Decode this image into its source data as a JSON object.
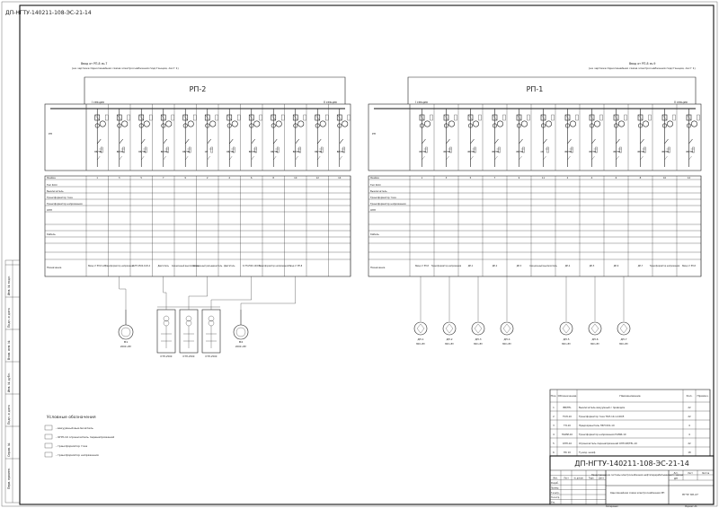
{
  "sheet": {
    "rotated_code": "ДП-НГТУ-140211-108-ЭС-21-14",
    "side_labels": [
      "Перв. примен.",
      "Справ. №",
      "Подп. и дата",
      "Инв. № дубл.",
      "Взам. инв. №",
      "Подп. и дата",
      "Инв. № подл."
    ]
  },
  "sections": [
    {
      "id": "left",
      "title": "РП-2",
      "feed_note_1": "Ввод от РП-8 яч.7",
      "feed_note_2": "(на чертеже Однолинейная схема электроснабжения подстанции, лист 1)",
      "bus_left_label": "I секция",
      "bus_right_label": "II секция",
      "cell_numbers": [
        "1",
        "3",
        "5",
        "7",
        "9",
        "2",
        "4",
        "6",
        "8",
        "10",
        "12",
        "14"
      ],
      "device_labels": [
        "ВВ/TEL",
        "ВВ/TEL",
        "ВВ/TEL",
        "ВВ/TEL",
        "ВВ/TEL",
        "СВ",
        "ВВ/TEL",
        "ВВ/TEL",
        "ВВ/TEL",
        "ВВ/TEL",
        "ВВ/TEL",
        "ВВ/TEL"
      ],
      "bottom_labels": [
        "Ввод от РП-8 яч.7",
        "Трансформатор напряжения",
        "К-ТП-2500-10/0,4",
        "Двигатель",
        "Секционный выключатель",
        "Секционный разъединитель",
        "Двигатель",
        "К-ТП-2500-10/0,4",
        "Трансформатор напряжения",
        "Ввод от РП-8"
      ],
      "row_titles": [
        "Ячейка",
        "Тип КСО",
        "Выключатель",
        "Трансформатор тока",
        "Трансформатор напряжения",
        "ОПН",
        "Кабель",
        "Назначение"
      ],
      "loads": [
        {
          "type": "motor",
          "label": "М1",
          "sub": "2000 кВт"
        },
        {
          "type": "ktp",
          "label": "КТП-2500"
        },
        {
          "type": "ktp",
          "label": "КТП-2500"
        },
        {
          "type": "ktp",
          "label": "КТП-2500"
        },
        {
          "type": "motor",
          "label": "М2",
          "sub": "2000 кВт"
        }
      ]
    },
    {
      "id": "right",
      "title": "РП-1",
      "feed_note_1": "Ввод от РП-8 яч.9",
      "feed_note_2": "(на чертеже Однолинейная схема электроснабжения подстанции, лист 1)",
      "bus_left_label": "I секция",
      "bus_right_label": "II секция",
      "cell_numbers": [
        "1",
        "3",
        "5",
        "7",
        "9",
        "11",
        "2",
        "4",
        "6",
        "8",
        "10",
        "12"
      ],
      "device_labels": [
        "ВВ/TEL",
        "ВВ/TEL",
        "ВВ/TEL",
        "ВВ/TEL",
        "ВВ/TEL",
        "СВ",
        "ВВ/TEL",
        "ВВ/TEL",
        "ВВ/TEL",
        "ВВ/TEL",
        "ВВ/TEL",
        "ВВ/TEL"
      ],
      "bottom_labels": [
        "Ввод от РП-8",
        "Трансформатор напряжения",
        "ДП-1",
        "ДП-2",
        "ДП-3",
        "Секционный выключатель",
        "ДП-4",
        "ДП-5",
        "ДП-6",
        "ДП-7",
        "Трансформатор напряжения",
        "Ввод от РП-8"
      ],
      "row_titles": [
        "Ячейка",
        "Тип КСО",
        "Выключатель",
        "Трансформатор тока",
        "Трансформатор напряжения",
        "ОПН",
        "Кабель",
        "Назначение"
      ],
      "loads": [
        {
          "type": "pump",
          "label": "ДП-1",
          "sub": "800 кВт"
        },
        {
          "type": "pump",
          "label": "ДП-2",
          "sub": "800 кВт"
        },
        {
          "type": "pump",
          "label": "ДП-3",
          "sub": "800 кВт"
        },
        {
          "type": "pump",
          "label": "ДП-4",
          "sub": "800 кВт"
        },
        {
          "type": "pump",
          "label": "ДП-5",
          "sub": "800 кВт"
        },
        {
          "type": "pump",
          "label": "ДП-6",
          "sub": "800 кВт"
        },
        {
          "type": "pump",
          "label": "ДП-7",
          "sub": "800 кВт"
        }
      ]
    }
  ],
  "legend": {
    "title": "Условные обозначения",
    "items": [
      "- вакуумный выключатель",
      "- ОПН-10 ограничитель перенапряжений",
      "- трансформатор тока",
      "- трансформатор напряжения"
    ]
  },
  "spec": {
    "headers": [
      "Поз.",
      "Обозначение",
      "Наименование",
      "Кол.",
      "Примеч."
    ],
    "rows": [
      [
        "1",
        "ВВ/TEL",
        "Выключатель вакуумный с приводом",
        "22",
        ""
      ],
      [
        "2",
        "ТОЛ-10",
        "Трансформатор тока ТОЛ-10-1-100/5",
        "22",
        ""
      ],
      [
        "3",
        "ТЛ-10",
        "Предохранитель ПКН 001-10",
        "4",
        ""
      ],
      [
        "4",
        "НАМИ-10",
        "Трансформатор напряжения НАМИ-10",
        "4",
        ""
      ],
      [
        "5",
        "ОПН-10",
        "Ограничитель перенапряжений ОПН-КР/TEL-10",
        "22",
        ""
      ],
      [
        "6",
        "ПК 10",
        "Ту-вод. шкаф",
        "18",
        ""
      ]
    ]
  },
  "title_block": {
    "code": "ДП-НГТУ-140211-108-ЭС-21-14",
    "project": "Проектирование системы электроснабжения нефтеперерабатывающего завода",
    "sheet_name": "Однолинейная схема электроснабжения РП",
    "stage": "ДП",
    "sheet": "",
    "sheets": "",
    "org": "НГТУ ЭЛ-27",
    "rows": [
      "Изм.",
      "Лист",
      "№ докум.",
      "Подп.",
      "Дата"
    ],
    "roles": [
      "Разраб.",
      "Провер.",
      "Т.контр.",
      "Н.контр.",
      "Утв."
    ],
    "format": "Формат А1",
    "copied": "Копировал"
  }
}
